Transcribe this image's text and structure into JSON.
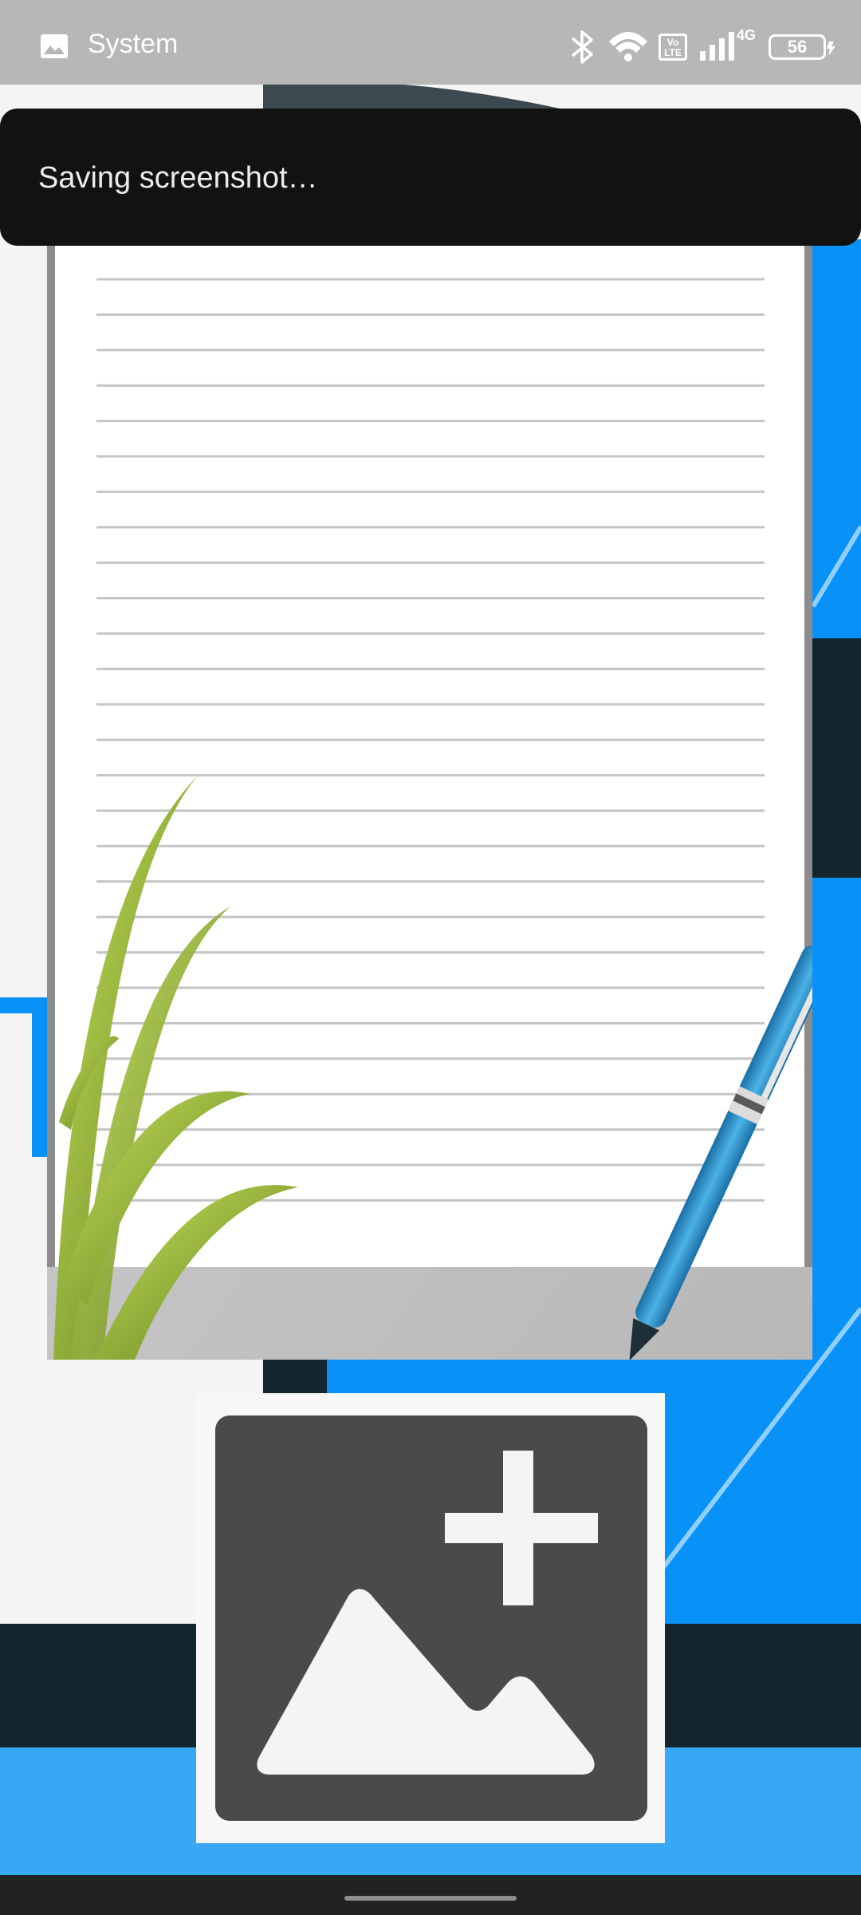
{
  "status_bar": {
    "notification_app": "System",
    "notification_icon": "gallery-icon",
    "network_type": "4G",
    "volte": "Vo LTE",
    "battery_level": "56",
    "icons": [
      "bluetooth-icon",
      "wifi-icon",
      "volte-icon",
      "signal-icon",
      "battery-icon",
      "charging-icon"
    ]
  },
  "toast": {
    "message": "Saving screenshot…"
  },
  "content": {
    "note_image_icon": "lined-note-paper-image",
    "add_image_icon": "add-image-icon"
  },
  "colors": {
    "status_bar": "#b7b7b7",
    "toast_bg": "#121212",
    "toast_text": "#ececec",
    "accent_blue": "#0891f7",
    "add_icon_fill": "#4a4a4a"
  }
}
